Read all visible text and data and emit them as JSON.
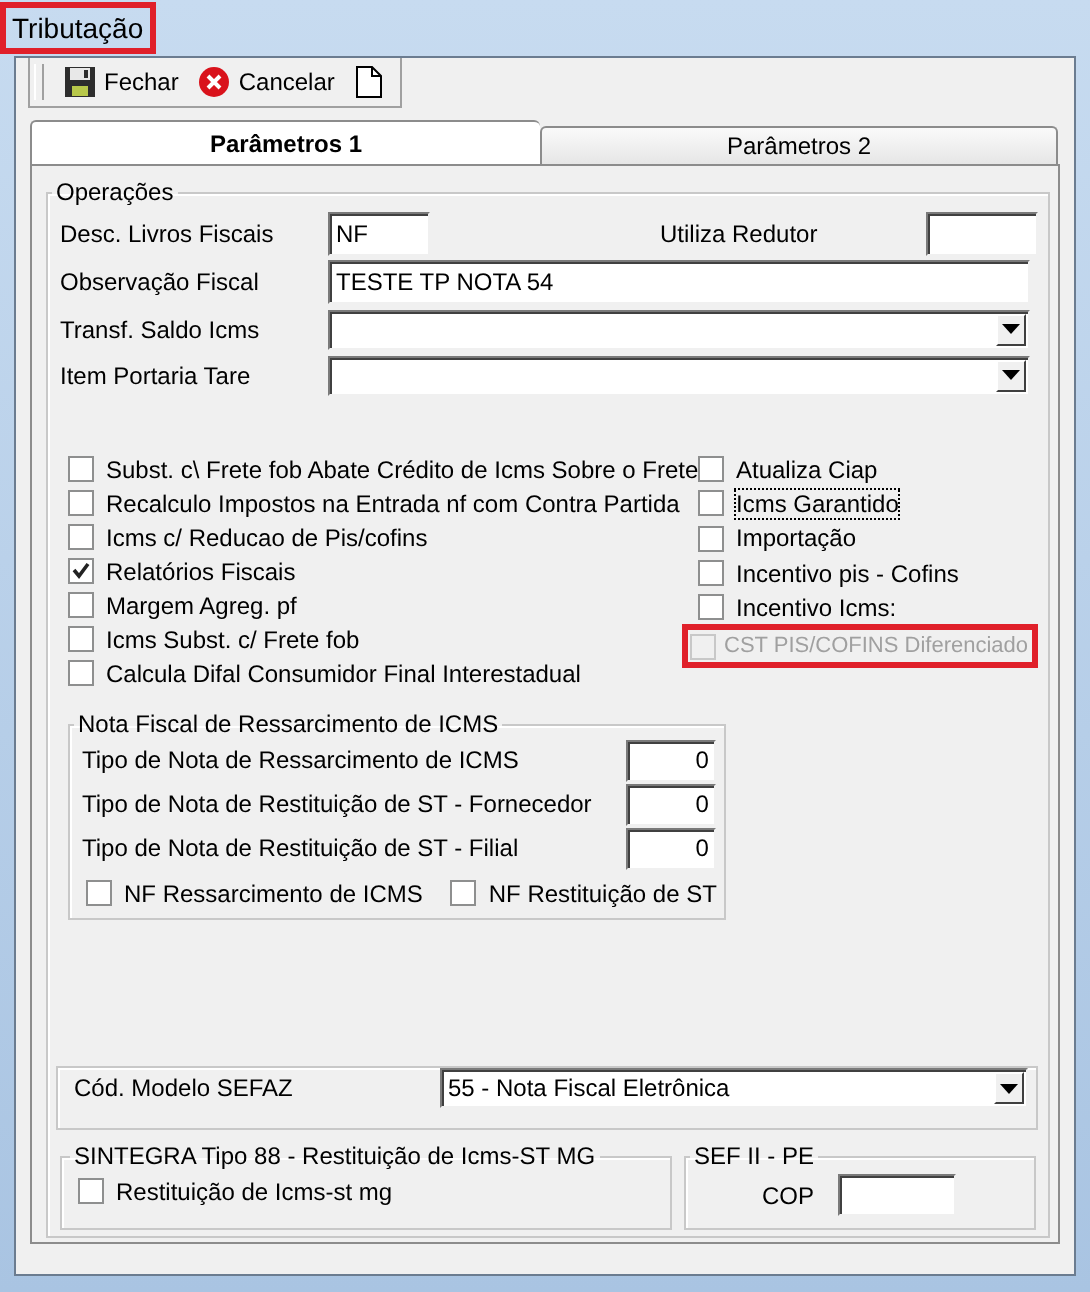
{
  "window": {
    "title": "Tributação",
    "highlighted": true
  },
  "toolbar": [
    {
      "kind": "save",
      "label": "Fechar"
    },
    {
      "kind": "cancel",
      "label": "Cancelar"
    },
    {
      "kind": "new"
    }
  ],
  "tabs": [
    {
      "label": "Parâmetros 1",
      "selected": true
    },
    {
      "label": "Parâmetros 2",
      "selected": false
    }
  ],
  "operacoes": {
    "title": "Operações",
    "desc_livros": {
      "label": "Desc. Livros Fiscais",
      "value": "NF"
    },
    "utiliza_redutor": {
      "label": "Utiliza Redutor"
    },
    "observacao": {
      "label": "Observação Fiscal",
      "value": "TESTE TP NOTA 54"
    },
    "combos": [
      {
        "label": "Transf. Saldo Icms"
      },
      {
        "label": "Item Portaria Tare"
      }
    ],
    "checks_left": [
      {
        "label": "Subst. c\\ Frete fob Abate Crédito de Icms Sobre o Frete",
        "checked": false
      },
      {
        "label": "Recalculo Impostos na Entrada nf com Contra Partida",
        "checked": false
      },
      {
        "label": "Icms c/ Reducao de Pis/cofins",
        "checked": false
      },
      {
        "label": "Relatórios Fiscais",
        "checked": true
      },
      {
        "label": "Margem Agreg. pf",
        "checked": false
      },
      {
        "label": "Icms Subst. c/ Frete fob",
        "checked": false
      },
      {
        "label": "Calcula Difal Consumidor Final Interestadual",
        "checked": false
      }
    ],
    "checks_right": [
      {
        "label": "Atualiza Ciap",
        "checked": false,
        "focused": false,
        "disabled": false,
        "highlighted": false
      },
      {
        "label": "Icms Garantido",
        "checked": false,
        "focused": true,
        "disabled": false,
        "highlighted": false
      },
      {
        "label": "Importação",
        "checked": false,
        "focused": false,
        "disabled": false,
        "highlighted": false
      },
      {
        "label": "Incentivo pis - Cofins",
        "checked": false,
        "focused": false,
        "disabled": false,
        "highlighted": false
      },
      {
        "label": "Incentivo Icms:",
        "checked": false,
        "focused": false,
        "disabled": false,
        "highlighted": false
      },
      {
        "label": "CST PIS/COFINS Diferenciado",
        "checked": false,
        "focused": false,
        "disabled": true,
        "highlighted": true
      }
    ],
    "ressarcimento": {
      "title": "Nota Fiscal de Ressarcimento de ICMS",
      "rows": [
        {
          "label": "Tipo de Nota de Ressarcimento de ICMS",
          "value": "0"
        },
        {
          "label": "Tipo de Nota de Restituição de ST - Fornecedor",
          "value": "0"
        },
        {
          "label": "Tipo de Nota de Restituição de ST - Filial",
          "value": "0"
        }
      ],
      "checks": [
        {
          "label": "NF Ressarcimento de ICMS",
          "checked": false
        },
        {
          "label": "NF Restituição de ST",
          "checked": false
        }
      ]
    },
    "modelo_sefaz": {
      "label": "Cód. Modelo SEFAZ",
      "value": "55 - Nota Fiscal Eletrônica"
    },
    "sintegra": {
      "title": "SINTEGRA Tipo 88 - Restituição de Icms-ST MG",
      "checks": [
        {
          "label": "Restituição de  Icms-st mg",
          "checked": false
        }
      ]
    },
    "sef": {
      "title": "SEF II - PE",
      "field": {
        "label": "COP"
      }
    }
  }
}
